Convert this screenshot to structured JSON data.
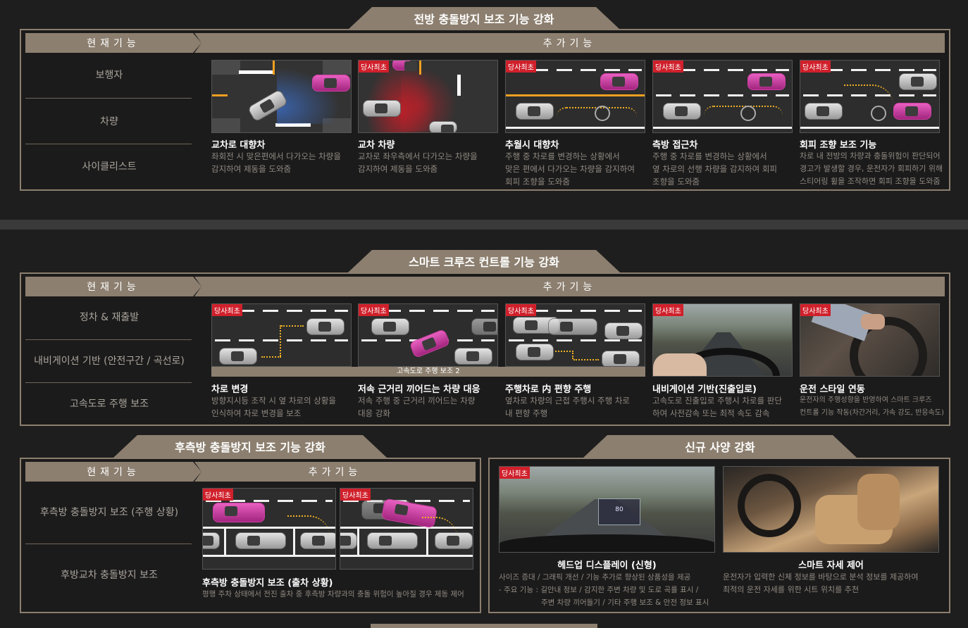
{
  "colors": {
    "accent": "#8c7f6f",
    "tag_red": "#d0202b",
    "lane_dots": "#f0b024",
    "highlight_car": "#c93a9f"
  },
  "s1": {
    "title": "전방 충돌방지 보조 기능 강화",
    "current_header": "현재기능",
    "added_header": "추가기능",
    "current": [
      "보행자",
      "차량",
      "사이클리스트"
    ],
    "cards": [
      {
        "tag": "",
        "title": "교차로 대향차",
        "desc1": "좌회전 시 맞은편에서 다가오는 차량을",
        "desc2": "감지하여 제동을 도와줌",
        "desc3": ""
      },
      {
        "tag": "당사최초",
        "title": "교차 차량",
        "desc1": "교차로 좌우측에서 다가오는 차량을",
        "desc2": "감지하여 제동을 도와줌",
        "desc3": ""
      },
      {
        "tag": "당사최초",
        "title": "추월시 대향차",
        "desc1": "주행 중 차로를 변경하는 상황에서",
        "desc2": "맞은 편에서 다가오는 차량을 감지하여",
        "desc3": "회피 조향을 도와줌"
      },
      {
        "tag": "당사최초",
        "title": "측방 접근차",
        "desc1": "주행 중 차로를 변경하는 상황에서",
        "desc2": "옆 차로의 선행 차량을 감지하여 회피",
        "desc3": "조향을 도와줌"
      },
      {
        "tag": "당사최초",
        "title": "회피 조향 보조 기능",
        "desc1": "차로 내 전방의 차량과 충돌위험이 판단되어",
        "desc2": "경고가 발생할 경우, 운전자가 회피하기 위해",
        "desc3": "스티어링 휠을 조작하면 회피 조향을 도와줌"
      }
    ]
  },
  "s2": {
    "title": "스마트 크루즈 컨트롤 기능 강화",
    "current_header": "현재기능",
    "added_header": "추가기능",
    "current": [
      "정차 & 재출발",
      "내비게이션 기반 (안전구간 / 곡선로)",
      "고속도로 주행 보조"
    ],
    "sub_label": "고속도로 주행 보조 2",
    "cards": [
      {
        "tag": "당사최초",
        "title": "차로 변경",
        "desc1": "방향지시등 조작 시 옆 차로의 상황을",
        "desc2": "인식하여 차로 변경을 보조"
      },
      {
        "tag": "당사최초",
        "title": "저속 근거리 끼어드는 차량 대응",
        "desc1": "저속 주행 중 근거리 끼어드는 차량",
        "desc2": "대응 강화"
      },
      {
        "tag": "당사최초",
        "title": "주행차로 内 편향 주행",
        "desc1": "옆차로 차량의 근접 주행시 주행 차로",
        "desc2": "내 편향 주행"
      },
      {
        "tag": "당사최초",
        "title": "내비게이션 기반(진출입로)",
        "desc1": "고속도로 진출입로 주행시 차로를 판단",
        "desc2": "하여 사전감속 또는 최적 속도 감속"
      },
      {
        "tag": "당사최초",
        "title": "운전 스타일 연동",
        "desc1": "운전자의 주행성향을 반영하여 스마트 크루즈",
        "desc2": "컨트롤 기능 작동(차간거리, 가속 강도, 반응속도)"
      }
    ]
  },
  "s3": {
    "title": "후측방 충돌방지 보조 기능 강화",
    "current_header": "현재기능",
    "added_header": "추가기능",
    "current": [
      "후측방 충돌방지 보조 (주행 상황)",
      "후방교차 충돌방지 보조"
    ],
    "tags": [
      "당사최초",
      "당사최초"
    ],
    "card_title": "후측방 충돌방지 보조 (출차 상황)",
    "card_desc": "평행 주차 상태에서 전진 출차 중 후측방 차량과의 충돌 위험이 높아질 경우 제동 제어"
  },
  "s4": {
    "title": "신규 사양 강화",
    "hud_tag": "당사최초",
    "hud_speed": "80",
    "hud_title": "헤드업 디스플레이 (신형)",
    "hud_desc1": "사이즈 증대 / 그래픽 개선 / 기능 추가로 향상된 상품성을 제공",
    "hud_desc2": "- 주요 기능 : 길안내 정보 / 감지한 주변 차량 및 도로 곡률 표시 /",
    "hud_desc3": "주변 차량 끼어들기 / 기타 주행 보조 & 안전 정보 표시",
    "seat_title": "스마트 자세 제어",
    "seat_desc1": "운전자가 입력한 신체 정보를 바탕으로 분석 정보를 제공하여",
    "seat_desc2": "최적의 운전 자세를 위한 시트 위치를 추천"
  }
}
